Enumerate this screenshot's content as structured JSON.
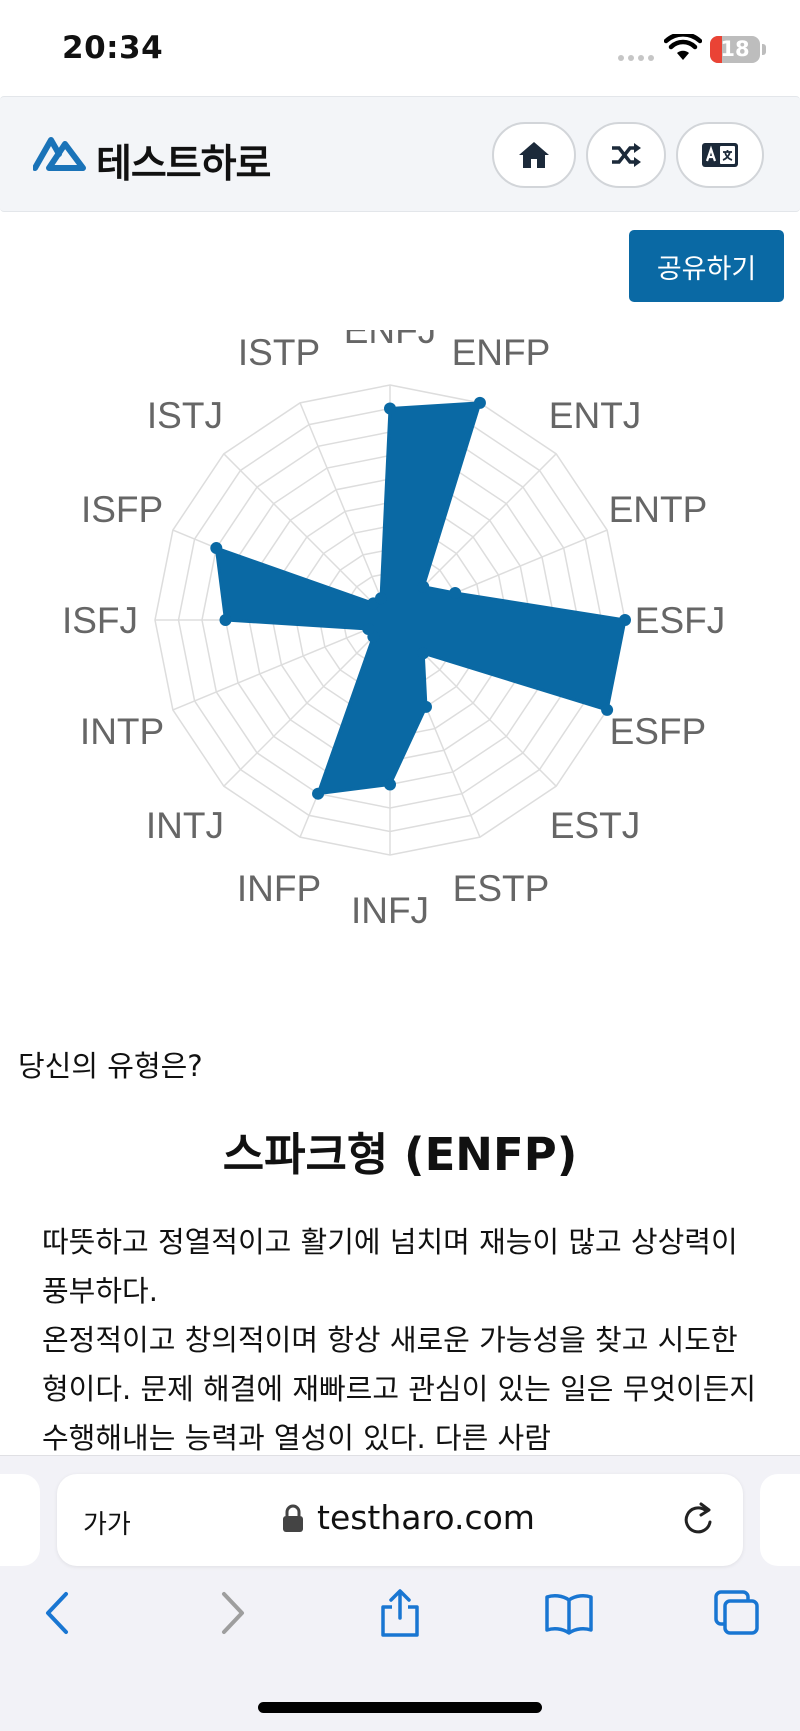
{
  "status_bar": {
    "time": "20:34",
    "battery_level": "18",
    "icons": [
      "signal-dots-icon",
      "wifi-icon",
      "battery-icon"
    ]
  },
  "header": {
    "logo_text": "테스트하로",
    "buttons": [
      "home-icon",
      "shuffle-icon",
      "translate-icon"
    ]
  },
  "share_button": "공유하기",
  "colors": {
    "accent": "#0a69a4",
    "grid": "#dddddd",
    "axis_label": "#666666"
  },
  "chart_data": {
    "type": "radar",
    "categories": [
      "ENFJ",
      "ENFP",
      "ENTJ",
      "ENTP",
      "ESFJ",
      "ESFP",
      "ESTJ",
      "ESTP",
      "INFJ",
      "INFP",
      "INTJ",
      "INTP",
      "ISFJ",
      "ISFP",
      "ISTJ",
      "ISTP"
    ],
    "values": [
      9,
      10,
      2,
      3,
      10,
      10,
      2,
      4,
      7,
      8,
      1,
      1,
      7,
      8,
      1,
      1
    ],
    "range": [
      0,
      10
    ],
    "grid": true,
    "grid_rings": 10
  },
  "result": {
    "prompt": "당신의 유형은?",
    "title": "스파크형 (ENFP)",
    "description": [
      "따뜻하고 정열적이고 활기에 넘치며 재능이 많고 상상력이 풍부하다.",
      "온정적이고 창의적이며 항상 새로운 가능성을 찾고 시도한 형이다. 문제 해결에 재빠르고 관심이 있는 일은 무엇이든지 수행해내는 능력과 열성이 있다. 다른 사람"
    ]
  },
  "browser": {
    "text_size_label": "가가",
    "url": "testharo.com",
    "toolbar": [
      "back-icon",
      "forward-icon",
      "share-icon",
      "bookmarks-icon",
      "tabs-icon"
    ]
  }
}
